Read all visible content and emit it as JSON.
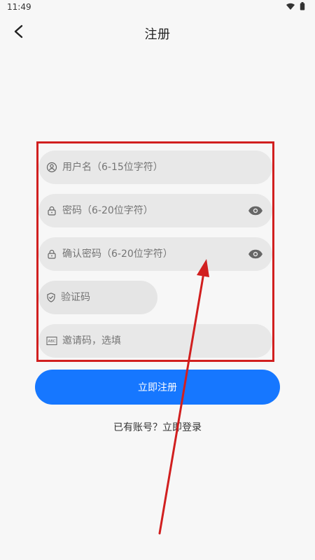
{
  "status_bar": {
    "time": "11:49",
    "icons": [
      "wifi-icon",
      "battery-icon"
    ]
  },
  "header": {
    "title": "注册",
    "back_icon": "chevron-left-icon"
  },
  "form": {
    "fields": [
      {
        "icon": "user-circle-icon",
        "placeholder": "用户名（6-15位字符）"
      },
      {
        "icon": "lock-icon",
        "placeholder": "密码（6-20位字符）",
        "has_visibility_toggle": true
      },
      {
        "icon": "lock-icon",
        "placeholder": "确认密码（6-20位字符）",
        "has_visibility_toggle": true
      },
      {
        "icon": "shield-icon",
        "placeholder": "验证码"
      },
      {
        "icon": "abc-icon",
        "placeholder": "邀请码，选填"
      }
    ]
  },
  "buttons": {
    "register": "立即注册"
  },
  "footer": {
    "login_text": "已有账号？立即登录"
  },
  "colors": {
    "primary": "#1677ff",
    "annotation": "#d11f1f",
    "field_bg": "#e8e8e8"
  }
}
